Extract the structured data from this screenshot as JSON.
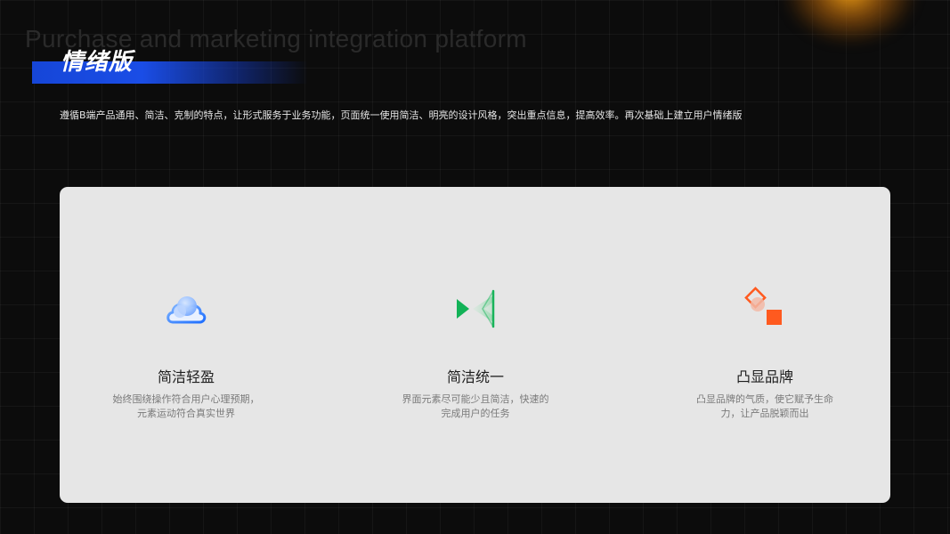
{
  "header": {
    "watermark": "Purchase and marketing integration platform",
    "title": "情绪版",
    "description": "遵循B端产品通用、简洁、克制的特点，让形式服务于业务功能，页面统一使用简洁、明亮的设计风格，突出重点信息，提高效率。再次基础上建立用户情绪版"
  },
  "features": [
    {
      "icon": "cloud-bubble-icon",
      "title": "简洁轻盈",
      "description_line1": "始终围绕操作符合用户心理预期，",
      "description_line2": "元素运动符合真实世界"
    },
    {
      "icon": "play-triangles-icon",
      "title": "简洁统一",
      "description_line1": "界面元素尽可能少且简洁，快速的",
      "description_line2": "完成用户的任务"
    },
    {
      "icon": "brand-shapes-icon",
      "title": "凸显品牌",
      "description_line1": "凸显品牌的气质，使它赋予生命",
      "description_line2": "力，让产品脱颖而出"
    }
  ],
  "colors": {
    "accent_blue": "#1a4de6",
    "accent_green": "#18b45a",
    "accent_orange": "#ff5a1f",
    "glow_orange": "#f4a014",
    "card_bg": "#e6e6e6"
  }
}
